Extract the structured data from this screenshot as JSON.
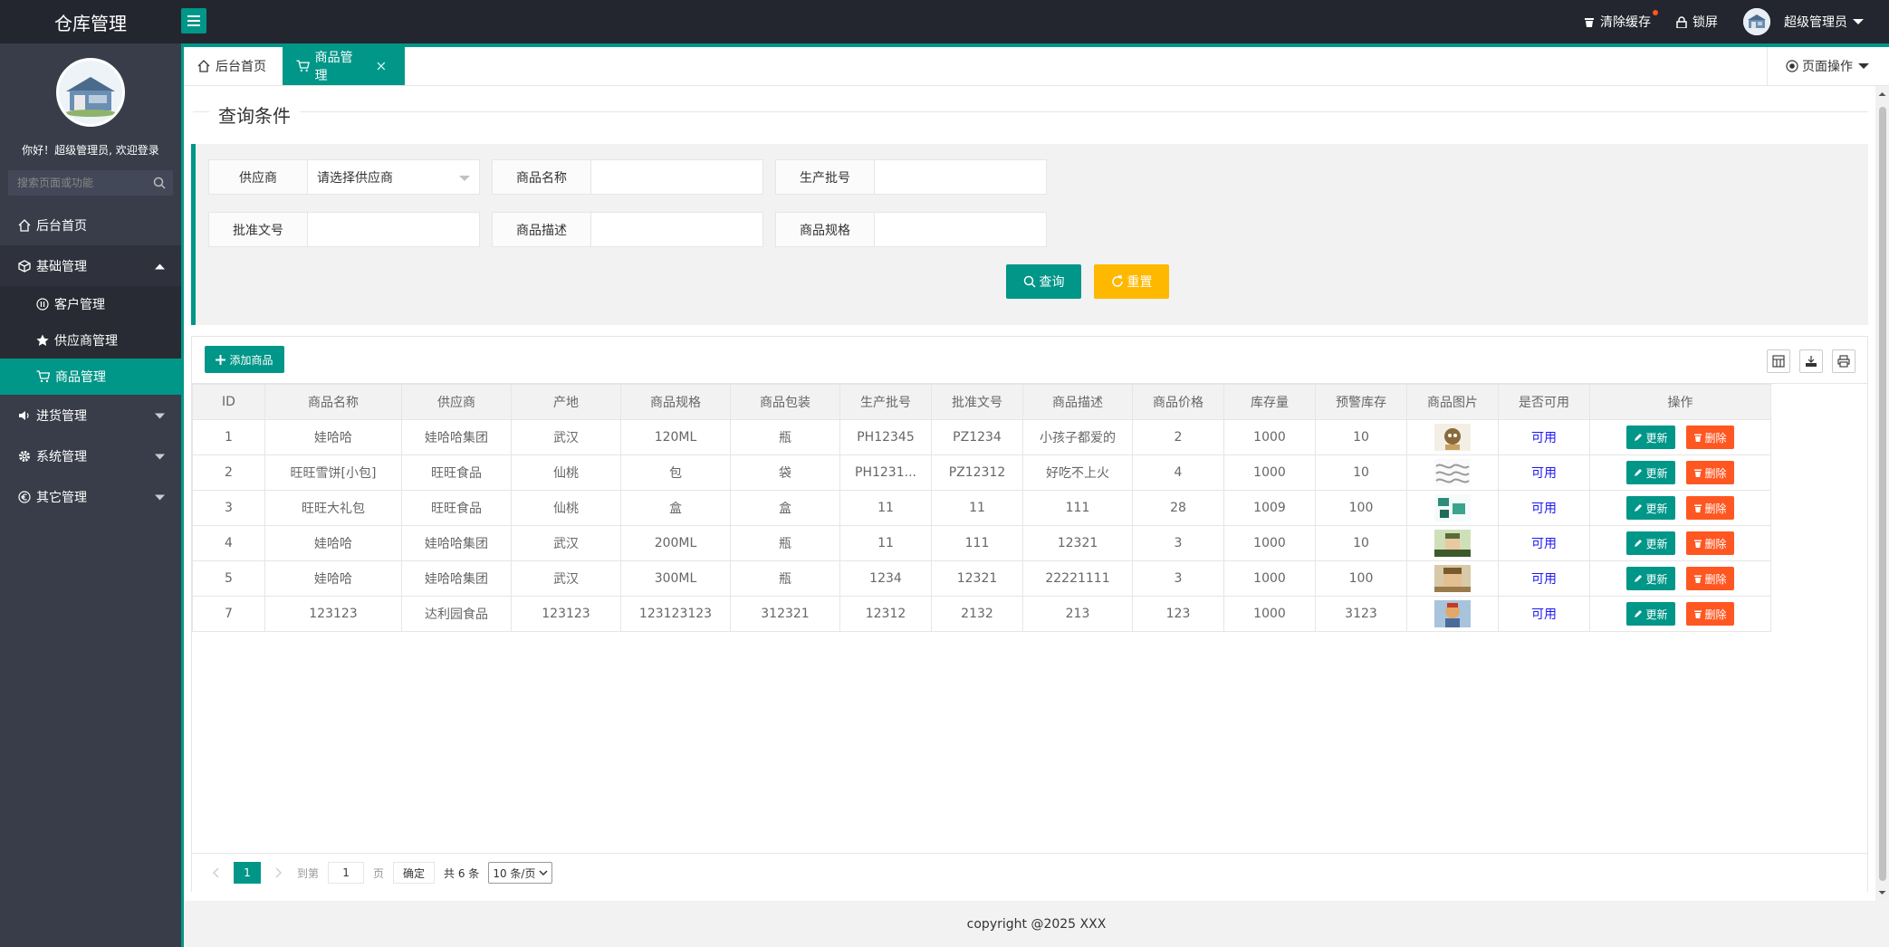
{
  "app": {
    "title": "仓库管理"
  },
  "topbar": {
    "clear_cache": "清除缓存",
    "lock_screen": "锁屏",
    "user_name": "超级管理员"
  },
  "sidebar": {
    "welcome": "你好！超级管理员, 欢迎登录",
    "search_placeholder": "搜索页面或功能",
    "items": [
      {
        "label": "后台首页",
        "icon": "home-icon"
      },
      {
        "label": "基础管理",
        "icon": "cube-icon",
        "open": true,
        "children": [
          {
            "label": "客户管理",
            "icon": "pause-circle-icon"
          },
          {
            "label": "供应商管理",
            "icon": "star-icon"
          },
          {
            "label": "商品管理",
            "icon": "cart-icon",
            "active": true
          }
        ]
      },
      {
        "label": "进货管理",
        "icon": "volume-icon"
      },
      {
        "label": "系统管理",
        "icon": "gear-icon"
      },
      {
        "label": "其它管理",
        "icon": "euro-circle-icon"
      }
    ]
  },
  "tabs": [
    {
      "label": "后台首页"
    },
    {
      "label": "商品管理",
      "active": true
    }
  ],
  "page_ops": "页面操作",
  "query": {
    "legend": "查询条件",
    "fields": [
      {
        "label": "供应商",
        "value": "请选择供应商",
        "select": true
      },
      {
        "label": "商品名称",
        "value": ""
      },
      {
        "label": "生产批号",
        "value": ""
      },
      {
        "label": "批准文号",
        "value": ""
      },
      {
        "label": "商品描述",
        "value": ""
      },
      {
        "label": "商品规格",
        "value": ""
      }
    ],
    "search_button": "查询",
    "reset_button": "重置"
  },
  "table": {
    "add_button": "添加商品",
    "columns": [
      "ID",
      "商品名称",
      "供应商",
      "产地",
      "商品规格",
      "商品包装",
      "生产批号",
      "批准文号",
      "商品描述",
      "商品价格",
      "库存量",
      "预警库存",
      "商品图片",
      "是否可用",
      "操作"
    ],
    "rows": [
      [
        "1",
        "娃哈哈",
        "娃哈哈集团",
        "武汉",
        "120ML",
        "瓶",
        "PH12345",
        "PZ1234",
        "小孩子都爱的",
        "2",
        "1000",
        "10",
        "",
        "可用"
      ],
      [
        "2",
        "旺旺雪饼[小包]",
        "旺旺食品",
        "仙桃",
        "包",
        "袋",
        "PH1231...",
        "PZ12312",
        "好吃不上火",
        "4",
        "1000",
        "10",
        "",
        "可用"
      ],
      [
        "3",
        "旺旺大礼包",
        "旺旺食品",
        "仙桃",
        "盒",
        "盒",
        "11",
        "11",
        "111",
        "28",
        "1009",
        "100",
        "",
        "可用"
      ],
      [
        "4",
        "娃哈哈",
        "娃哈哈集团",
        "武汉",
        "200ML",
        "瓶",
        "11",
        "111",
        "12321",
        "3",
        "1000",
        "10",
        "",
        "可用"
      ],
      [
        "5",
        "娃哈哈",
        "娃哈哈集团",
        "武汉",
        "300ML",
        "瓶",
        "1234",
        "12321",
        "22221111",
        "3",
        "1000",
        "100",
        "",
        "可用"
      ],
      [
        "7",
        "123123",
        "达利园食品",
        "123123",
        "123123123",
        "312321",
        "12312",
        "2132",
        "213",
        "123",
        "1000",
        "3123",
        "",
        "可用"
      ]
    ],
    "update_label": "更新",
    "delete_label": "删除"
  },
  "pager": {
    "current": "1",
    "goto_label": "到第",
    "goto_value": "1",
    "page_unit": "页",
    "confirm": "确定",
    "total": "共 6 条",
    "page_size": "10 条/页"
  },
  "footer": {
    "copyright": "copyright @2025 XXX"
  },
  "colors": {
    "primary": "#009688",
    "warn": "#ffb800",
    "danger": "#ff5722",
    "sidebar": "#393d49",
    "topbar": "#23262e"
  }
}
